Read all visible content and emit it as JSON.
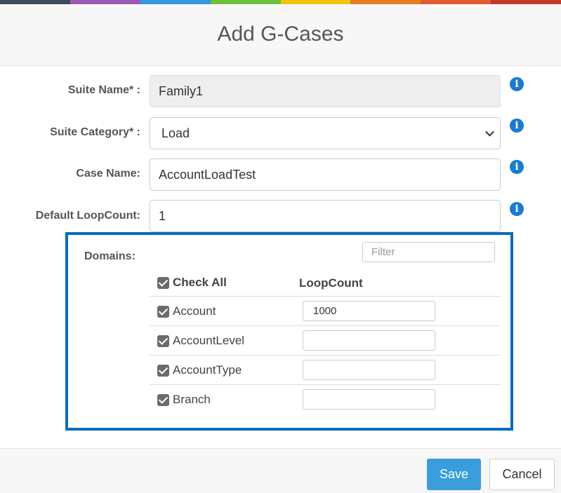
{
  "colors": {
    "top_bar": [
      "#3f4a5a",
      "#9b59b6",
      "#3498db",
      "#6dbf3b",
      "#f1c40f",
      "#e67e22",
      "#e05a33",
      "#c0392b"
    ],
    "accent": "#0b6cbd",
    "primary_button": "#3a9ddc",
    "info_icon": "#1a7bd0"
  },
  "modal": {
    "title": "Add G-Cases"
  },
  "form": {
    "suite_name": {
      "label": "Suite Name* :",
      "value": "Family1"
    },
    "suite_category": {
      "label": "Suite Category* :",
      "value": "Load"
    },
    "case_name": {
      "label": "Case Name:",
      "value": "AccountLoadTest"
    },
    "default_loopcount": {
      "label": "Default LoopCount:",
      "value": "1"
    },
    "info_icon": "i"
  },
  "domains": {
    "label": "Domains:",
    "filter_placeholder": "Filter",
    "check_all_label": "Check All",
    "loopcount_header": "LoopCount",
    "rows": [
      {
        "name": "Account",
        "checked": true,
        "loopcount": "1000"
      },
      {
        "name": "AccountLevel",
        "checked": true,
        "loopcount": ""
      },
      {
        "name": "AccountType",
        "checked": true,
        "loopcount": ""
      },
      {
        "name": "Branch",
        "checked": true,
        "loopcount": ""
      }
    ]
  },
  "footer": {
    "save_label": "Save",
    "cancel_label": "Cancel"
  }
}
